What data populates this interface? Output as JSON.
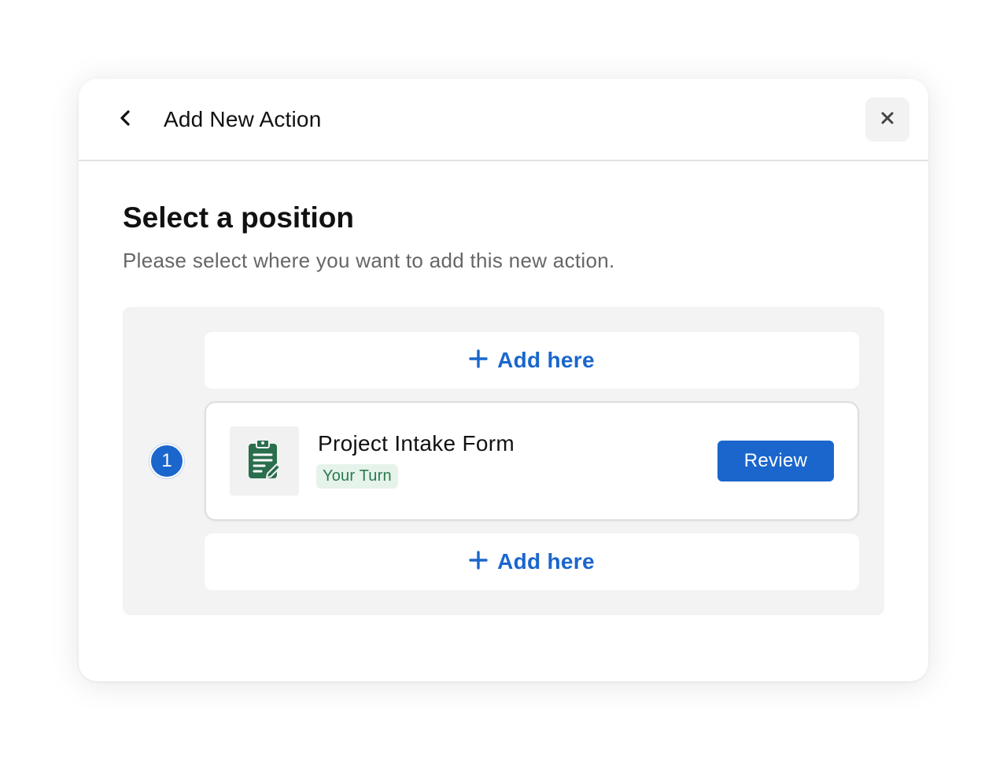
{
  "header": {
    "title": "Add New Action",
    "back_icon": "chevron-left-icon",
    "close_icon": "close-icon"
  },
  "section": {
    "title": "Select a position",
    "subtitle": "Please select where you want to add this new action."
  },
  "slots": {
    "add_label": "Add here",
    "add_icon": "plus-icon"
  },
  "steps": [
    {
      "number": "1",
      "title": "Project Intake Form",
      "status": "Your Turn",
      "action_label": "Review",
      "icon": "clipboard-edit-icon"
    }
  ],
  "colors": {
    "accent": "#1a66cc",
    "status_bg": "#e6f3ea",
    "status_text": "#2a7a4f",
    "icon_green": "#2a6e4d"
  }
}
